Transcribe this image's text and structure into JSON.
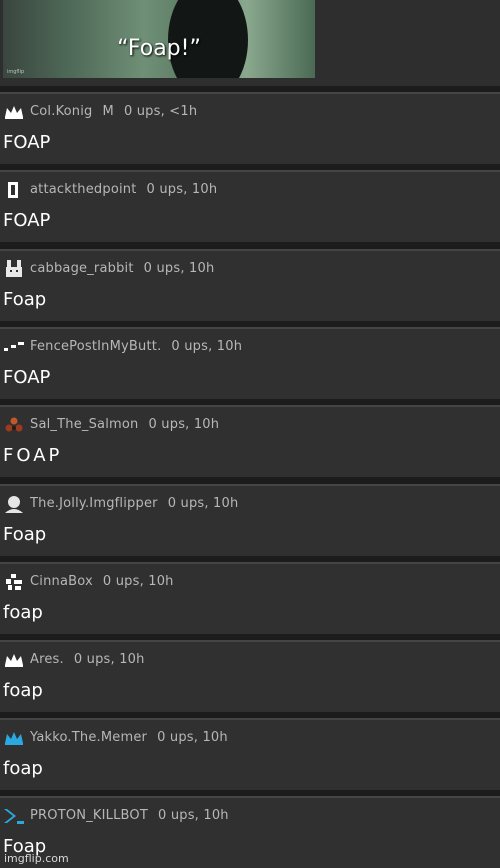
{
  "meme": {
    "caption": "“Foap!”",
    "tiny_text": "imgflip"
  },
  "comments": [
    {
      "user": "Col.Konig",
      "badge": "M",
      "meta": "0 ups, <1h",
      "text": "FOAP",
      "avatar": "crown-icon"
    },
    {
      "user": "attackthedpoint",
      "meta": "0 ups, 10h",
      "text": "FOAP",
      "avatar": "bracket-icon"
    },
    {
      "user": "cabbage_rabbit",
      "meta": "0 ups, 10h",
      "text": "Foap",
      "avatar": "rabbit-icon"
    },
    {
      "user": "FencePostInMyButt.",
      "meta": "0 ups, 10h",
      "text": "FOAP",
      "avatar": "dashes-icon"
    },
    {
      "user": "Sal_The_Salmon",
      "meta": "0 ups, 10h",
      "text": "FOAP",
      "avatar": "pyramid-icon"
    },
    {
      "user": "The.Jolly.Imgflipper",
      "meta": "0 ups, 10h",
      "text": "Foap",
      "avatar": "person-icon"
    },
    {
      "user": "CinnaBox",
      "meta": "0 ups, 10h",
      "text": "foap",
      "avatar": "pixel-blocks-icon"
    },
    {
      "user": "Ares.",
      "meta": "0 ups, 10h",
      "text": "foap",
      "avatar": "crown-icon"
    },
    {
      "user": "Yakko.The.Memer",
      "meta": "0 ups, 10h",
      "text": "foap",
      "avatar": "blue-crown-icon"
    },
    {
      "user": "PROTON_KILLBOT",
      "meta": "0 ups, 10h",
      "text": "Foap",
      "avatar": "arrow-icon"
    }
  ],
  "colors": {
    "background": "#1c1c1c",
    "card": "#303030",
    "username": "#b7b7b7",
    "comment_text": "#ffffff",
    "blue_avatar": "#2aa8e0"
  },
  "watermark": "imgflip.com"
}
